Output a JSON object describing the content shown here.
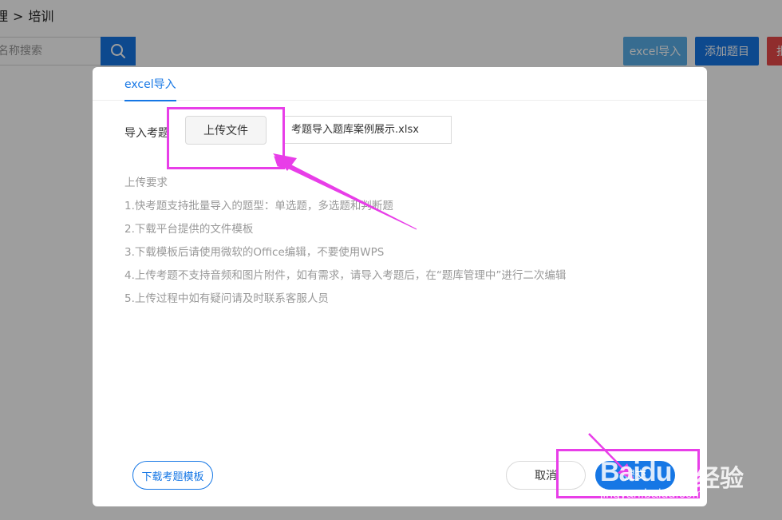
{
  "page": {
    "breadcrumb_prefix": "理",
    "breadcrumb_separator": ">",
    "breadcrumb_current": "培训",
    "search_placeholder": "名称搜索",
    "buttons": {
      "excel_import": "excel导入",
      "add_question": "添加题目",
      "partial": "批"
    }
  },
  "modal": {
    "tab_label": "excel导入",
    "import_label": "导入考题",
    "upload_button": "上传文件",
    "file_name": "考题导入题库案例展示.xlsx",
    "requirements_title": "上传要求",
    "requirements": [
      "1.快考题支持批量导入的题型：单选题，多选题和判断题",
      "2.下载平台提供的文件模板",
      "3.下载模板后请使用微软的Office编辑，不要使用WPS",
      "4.上传考题不支持音频和图片附件，如有需求，请导入考题后，在“题库管理中”进行二次编辑",
      "5.上传过程中如有疑问请及时联系客服人员"
    ],
    "download_template": "下载考题模板",
    "cancel": "取消",
    "submit": "提交"
  },
  "watermark": {
    "logo_bai": "Bai",
    "logo_du": "du",
    "logo_cn": "经验",
    "url": "jingyan.baidu.com"
  },
  "colors": {
    "primary": "#1677e5",
    "annotation": "#e83ee8",
    "excel_button": "#5aaee8",
    "danger": "#e84a4a"
  }
}
